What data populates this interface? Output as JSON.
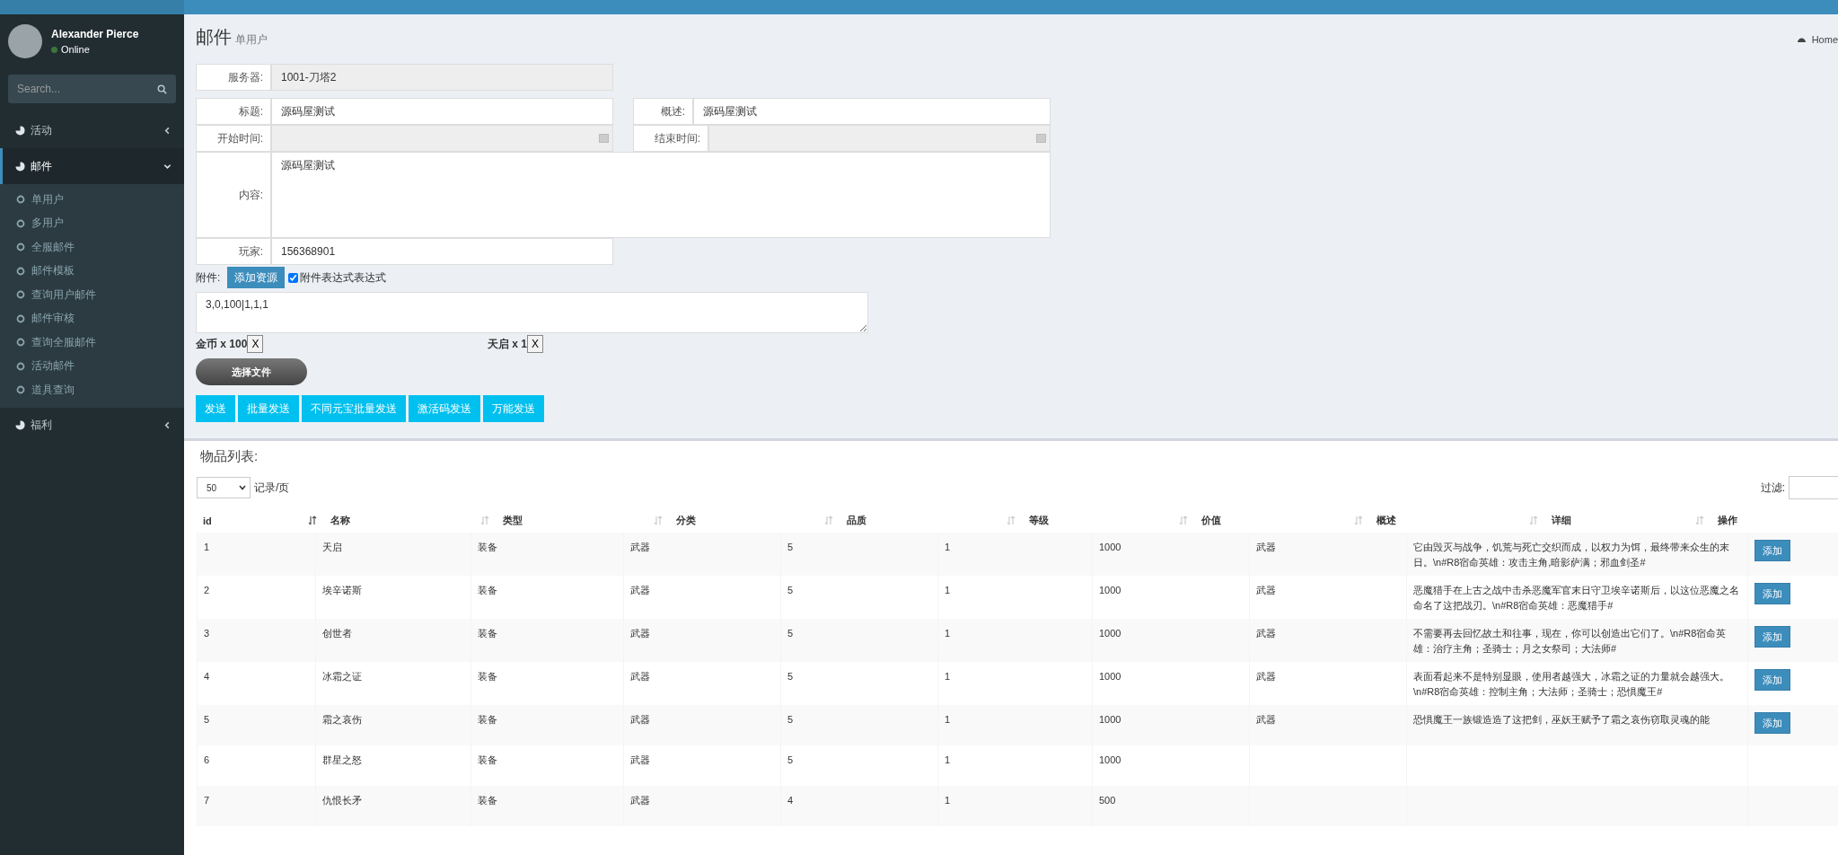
{
  "user": {
    "name": "Alexander Pierce",
    "status": "Online"
  },
  "sidebar": {
    "search_placeholder": "Search...",
    "items": [
      {
        "label": "活动",
        "expanded": false
      },
      {
        "label": "邮件",
        "expanded": true,
        "children": [
          {
            "label": "单用户"
          },
          {
            "label": "多用户"
          },
          {
            "label": "全服邮件"
          },
          {
            "label": "邮件模板"
          },
          {
            "label": "查询用户邮件"
          },
          {
            "label": "邮件审核"
          },
          {
            "label": "查询全服邮件"
          },
          {
            "label": "活动邮件"
          },
          {
            "label": "道具查询"
          }
        ]
      },
      {
        "label": "福利",
        "expanded": false
      }
    ]
  },
  "page": {
    "title": "邮件",
    "subtitle": "单用户",
    "breadcrumb": "Home"
  },
  "form": {
    "server": {
      "label": "服务器:",
      "value": "1001-刀塔2"
    },
    "title": {
      "label": "标题:",
      "value": "源码屋测试"
    },
    "summary": {
      "label": "概述:",
      "value": "源码屋测试"
    },
    "start_time": {
      "label": "开始时间:"
    },
    "end_time": {
      "label": "结束时间:"
    },
    "content": {
      "label": "内容:",
      "value": "源码屋测试"
    },
    "player": {
      "label": "玩家:",
      "value": "156368901"
    },
    "attachment": {
      "label": "附件:",
      "add_button": "添加资源",
      "checkbox_label": "附件表达式表达式",
      "checked": true,
      "expression": "3,0,100|1,1,1"
    },
    "items": [
      {
        "text": "金币 x 100",
        "remove": "X"
      },
      {
        "text": "天启 x 1",
        "remove": "X"
      }
    ],
    "file_button": "选择文件",
    "buttons": [
      "发送",
      "批量发送",
      "不同元宝批量发送",
      "激活码发送",
      "万能发送"
    ]
  },
  "list": {
    "title": "物品列表:",
    "page_size": "50",
    "page_size_label": "记录/页",
    "filter_label": "过滤:",
    "columns": [
      {
        "label": "id",
        "sortable": true,
        "sorted": true
      },
      {
        "label": "名称",
        "sortable": true,
        "sorted": false
      },
      {
        "label": "类型",
        "sortable": true,
        "sorted": false
      },
      {
        "label": "分类",
        "sortable": true,
        "sorted": false
      },
      {
        "label": "品质",
        "sortable": true,
        "sorted": false
      },
      {
        "label": "等级",
        "sortable": true,
        "sorted": false
      },
      {
        "label": "价值",
        "sortable": true,
        "sorted": false
      },
      {
        "label": "概述",
        "sortable": true,
        "sorted": false
      },
      {
        "label": "详细",
        "sortable": true,
        "sorted": false
      },
      {
        "label": "操作",
        "sortable": false
      }
    ],
    "rows": [
      {
        "cells": [
          "1",
          "天启",
          "装备",
          "武器",
          "5",
          "1",
          "1000",
          "武器",
          "它由毁灭与战争，饥荒与死亡交织而成，以权力为饵，最终带来众生的末日。\\n#R8宿命英雄：攻击主角,暗影萨满；邪血剑圣#"
        ],
        "action": "添加"
      },
      {
        "cells": [
          "2",
          "埃辛诺斯",
          "装备",
          "武器",
          "5",
          "1",
          "1000",
          "武器",
          "恶魔猎手在上古之战中击杀恶魔军官末日守卫埃辛诺斯后，以这位恶魔之名命名了这把战刃。\\n#R8宿命英雄：恶魔猎手#"
        ],
        "action": "添加"
      },
      {
        "cells": [
          "3",
          "创世者",
          "装备",
          "武器",
          "5",
          "1",
          "1000",
          "武器",
          "不需要再去回忆故土和往事，现在，你可以创造出它们了。\\n#R8宿命英雄：治疗主角；圣骑士；月之女祭司；大法师#"
        ],
        "action": "添加"
      },
      {
        "cells": [
          "4",
          "冰霜之证",
          "装备",
          "武器",
          "5",
          "1",
          "1000",
          "武器",
          "表面看起来不是特别显眼，使用者越强大，冰霜之证的力量就会越强大。\\n#R8宿命英雄：控制主角；大法师；圣骑士；恐惧魔王#"
        ],
        "action": "添加"
      },
      {
        "cells": [
          "5",
          "霜之哀伤",
          "装备",
          "武器",
          "5",
          "1",
          "1000",
          "武器",
          "恐惧魔王一族锻造造了这把剑，巫妖王赋予了霜之哀伤窃取灵魂的能"
        ],
        "action": "添加"
      },
      {
        "cells": [
          "6",
          "群星之怒",
          "装备",
          "武器",
          "5",
          "1",
          "1000"
        ]
      },
      {
        "cells": [
          "7",
          "仇恨长矛",
          "装备",
          "武器",
          "4",
          "1",
          "500"
        ]
      }
    ]
  }
}
